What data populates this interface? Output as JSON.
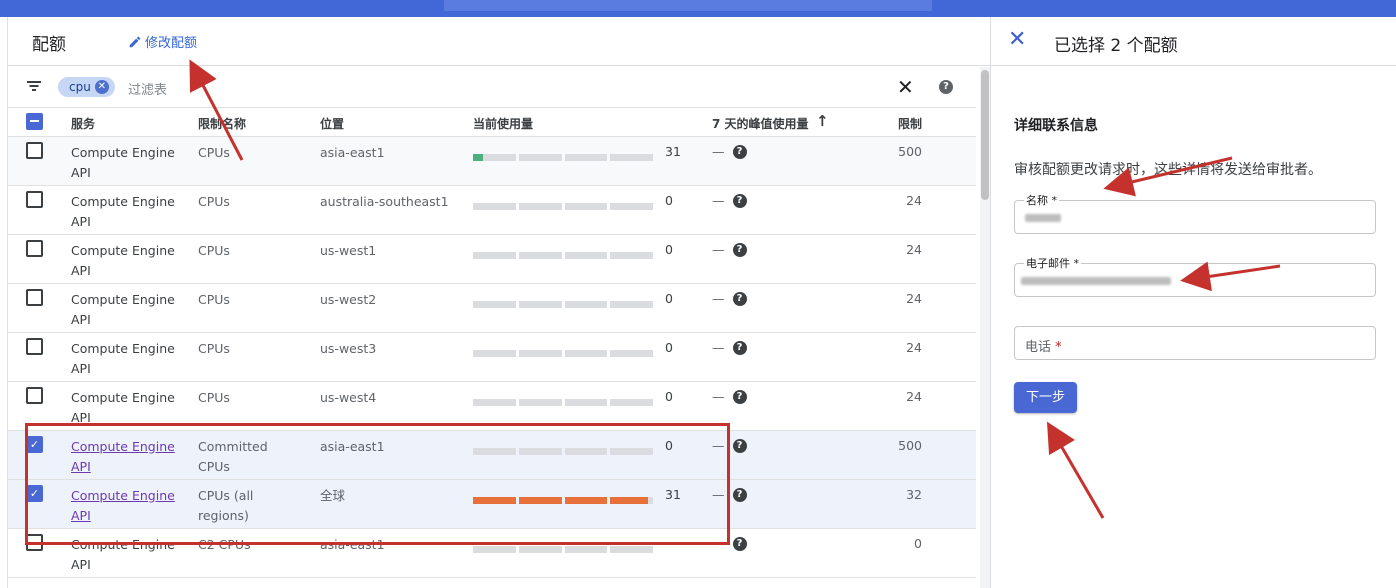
{
  "header": {
    "title": "配额",
    "edit_label": "修改配额"
  },
  "filter": {
    "chip": "cpu",
    "placeholder": "过滤表"
  },
  "columns": {
    "checkbox": "",
    "service": "服务",
    "limit_name": "限制名称",
    "location": "位置",
    "current_usage": "当前使用量",
    "peak_usage": "7 天的峰值使用量",
    "limit": "限制"
  },
  "rows": [
    {
      "service": "Compute Engine API",
      "limit_name": "CPUs",
      "location": "asia-east1",
      "usage": "31",
      "usage_fraction": 0.06,
      "peak": "—",
      "limit": "500",
      "checked": false
    },
    {
      "service": "Compute Engine API",
      "limit_name": "CPUs",
      "location": "australia-southeast1",
      "usage": "0",
      "usage_fraction": 0,
      "peak": "—",
      "limit": "24",
      "checked": false
    },
    {
      "service": "Compute Engine API",
      "limit_name": "CPUs",
      "location": "us-west1",
      "usage": "0",
      "usage_fraction": 0,
      "peak": "—",
      "limit": "24",
      "checked": false
    },
    {
      "service": "Compute Engine API",
      "limit_name": "CPUs",
      "location": "us-west2",
      "usage": "0",
      "usage_fraction": 0,
      "peak": "—",
      "limit": "24",
      "checked": false
    },
    {
      "service": "Compute Engine API",
      "limit_name": "CPUs",
      "location": "us-west3",
      "usage": "0",
      "usage_fraction": 0,
      "peak": "—",
      "limit": "24",
      "checked": false
    },
    {
      "service": "Compute Engine API",
      "limit_name": "CPUs",
      "location": "us-west4",
      "usage": "0",
      "usage_fraction": 0,
      "peak": "—",
      "limit": "24",
      "checked": false
    },
    {
      "service": "Compute Engine API",
      "limit_name": "Committed CPUs",
      "location": "asia-east1",
      "usage": "0",
      "usage_fraction": 0,
      "peak": "—",
      "limit": "500",
      "checked": true
    },
    {
      "service": "Compute Engine API",
      "limit_name": "CPUs (all regions)",
      "location": "全球",
      "usage": "31",
      "usage_fraction": 0.97,
      "peak": "—",
      "limit": "32",
      "checked": true
    },
    {
      "service": "Compute Engine API",
      "limit_name": "C2 CPUs",
      "location": "asia-east1",
      "usage": "",
      "usage_fraction": 0,
      "peak": "—",
      "limit": "0",
      "checked": false
    }
  ],
  "panel": {
    "title": "已选择 2 个配额",
    "section": "详细联系信息",
    "description": "审核配额更改请求时，这些详情将发送给审批者。",
    "name_label": "名称 *",
    "email_label": "电子邮件 *",
    "phone_label": "电话",
    "phone_required": "*",
    "next_label": "下一步"
  },
  "colors": {
    "accent": "#4a68d3",
    "topbar": "#4267d6",
    "usage_low": "#4caf7d",
    "usage_high": "#e8703a",
    "annotation": "#c5322e"
  }
}
